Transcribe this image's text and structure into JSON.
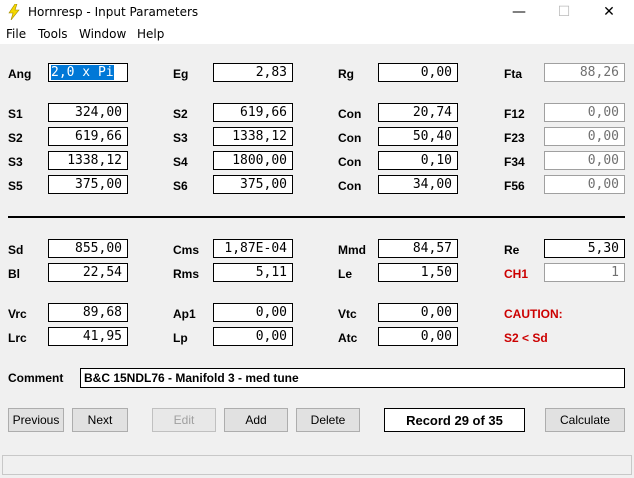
{
  "window": {
    "title": "Hornresp - Input Parameters",
    "minimize": "—",
    "maximize": "☐",
    "close": "✕"
  },
  "menu": [
    "File",
    "Tools",
    "Window",
    "Help"
  ],
  "row1": [
    {
      "label": "Ang",
      "value": "2,0 x Pi"
    },
    {
      "label": "Eg",
      "value": "2,83"
    },
    {
      "label": "Rg",
      "value": "0,00"
    },
    {
      "label": "Fta",
      "value": "88,26"
    }
  ],
  "row2": [
    {
      "label": "S1",
      "value": "324,00"
    },
    {
      "label": "S2",
      "value": "619,66"
    },
    {
      "label": "Con",
      "value": "20,74"
    },
    {
      "label": "F12",
      "value": "0,00"
    }
  ],
  "row3": [
    {
      "label": "S2",
      "value": "619,66"
    },
    {
      "label": "S3",
      "value": "1338,12"
    },
    {
      "label": "Con",
      "value": "50,40"
    },
    {
      "label": "F23",
      "value": "0,00"
    }
  ],
  "row4": [
    {
      "label": "S3",
      "value": "1338,12"
    },
    {
      "label": "S4",
      "value": "1800,00"
    },
    {
      "label": "Con",
      "value": "0,10"
    },
    {
      "label": "F34",
      "value": "0,00"
    }
  ],
  "row5": [
    {
      "label": "S5",
      "value": "375,00"
    },
    {
      "label": "S6",
      "value": "375,00"
    },
    {
      "label": "Con",
      "value": "34,00"
    },
    {
      "label": "F56",
      "value": "0,00"
    }
  ],
  "row6": [
    {
      "label": "Sd",
      "value": "855,00"
    },
    {
      "label": "Cms",
      "value": "1,87E-04"
    },
    {
      "label": "Mmd",
      "value": "84,57"
    },
    {
      "label": "Re",
      "value": "5,30"
    }
  ],
  "row7": [
    {
      "label": "Bl",
      "value": "22,54"
    },
    {
      "label": "Rms",
      "value": "5,11"
    },
    {
      "label": "Le",
      "value": "1,50"
    },
    {
      "label": "CH1",
      "value": "1"
    }
  ],
  "row8": [
    {
      "label": "Vrc",
      "value": "89,68"
    },
    {
      "label": "Ap1",
      "value": "0,00"
    },
    {
      "label": "Vtc",
      "value": "0,00"
    },
    {
      "label": "CAUTION:"
    }
  ],
  "row9": [
    {
      "label": "Lrc",
      "value": "41,95"
    },
    {
      "label": "Lp",
      "value": "0,00"
    },
    {
      "label": "Atc",
      "value": "0,00"
    },
    {
      "label": "S2 < Sd"
    }
  ],
  "comment": {
    "label": "Comment",
    "value": "B&C 15NDL76 - Manifold 3 - med tune"
  },
  "buttons": {
    "previous": "Previous",
    "next": "Next",
    "edit": "Edit",
    "add": "Add",
    "delete": "Delete",
    "record": "Record 29 of 35",
    "calculate": "Calculate"
  },
  "colors": {
    "caution": "#cc0000",
    "selection": "#0078d7"
  }
}
